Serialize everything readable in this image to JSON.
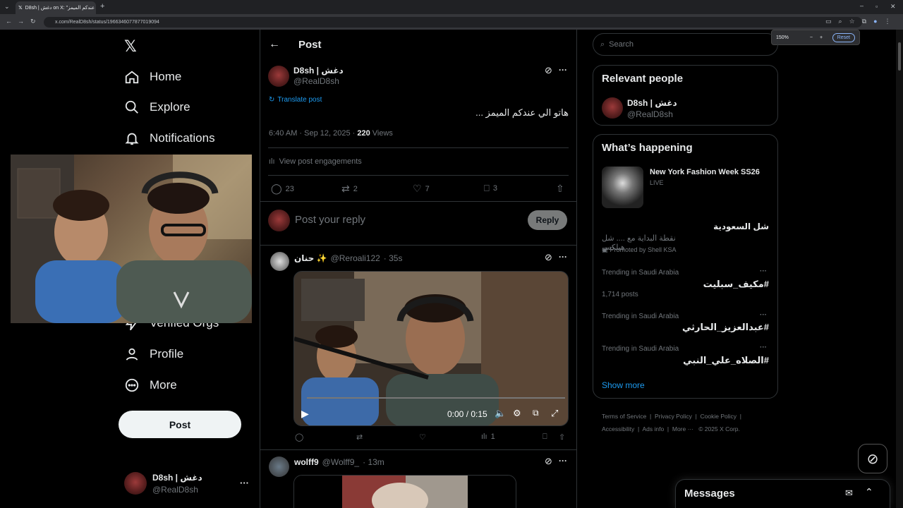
{
  "browser": {
    "tab_title": "D8sh | دغش on X: \"هاتو الي عندكم الميمز\" / X",
    "url": "x.com/RealD8sh/status/1966346077877019094",
    "zoom_level": "150%",
    "zoom_reset": "Reset",
    "zoom_minus": "−",
    "zoom_plus": "+"
  },
  "nav": {
    "items": [
      {
        "label": "Home",
        "icon": "home-icon"
      },
      {
        "label": "Explore",
        "icon": "search-icon"
      },
      {
        "label": "Notifications",
        "icon": "bell-icon"
      },
      {
        "label": "Verified Orgs",
        "icon": "lightning-icon"
      },
      {
        "label": "Profile",
        "icon": "person-icon"
      },
      {
        "label": "More",
        "icon": "more-circle-icon"
      }
    ],
    "post_button": "Post",
    "account_name": "D8sh | دغش",
    "account_handle": "@RealD8sh",
    "account_more": "···"
  },
  "main": {
    "header_title": "Post",
    "tweet": {
      "author_name": "D8sh | دغش",
      "author_handle": "@RealD8sh",
      "translate": "Translate post",
      "text": "هاتو الي عندكم الميمز ...",
      "time": "6:40 AM · Sep 12, 2025 · ",
      "views_count": "220",
      "views_label": " Views",
      "engagements": "View post engagements",
      "replies": "23",
      "reposts": "2",
      "likes": "7",
      "bookmarks": "3"
    },
    "reply_box": {
      "placeholder": "Post your reply",
      "button": "Reply"
    },
    "replies": [
      {
        "author_name": "حنان ✨",
        "author_handle": "@Reroali122",
        "time": "· 35s",
        "video_time": "0:00 / 0:15",
        "views": "1"
      },
      {
        "author_name": "wolff9",
        "author_handle": "@Wolff9_",
        "time": "· 13m"
      }
    ]
  },
  "sidebar": {
    "search_placeholder": "Search",
    "relevant_title": "Relevant people",
    "relevant_name": "D8sh | دغش",
    "relevant_handle": "@RealD8sh",
    "happening_title": "What’s happening",
    "event_title": "New York Fashion Week SS26",
    "event_status": "LIVE",
    "promo_title": "شل السعودية",
    "promo_sub": "نقطة البداية مع .... شل هيلكس",
    "promo_by": "Promoted by Shell KSA",
    "trends": [
      {
        "label": "Trending in Saudi Arabia",
        "title": "#مكيف_سبليت",
        "posts": "1,714 posts"
      },
      {
        "label": "Trending in Saudi Arabia",
        "title": "#عبدالعزيز_الحارثي",
        "posts": ""
      },
      {
        "label": "Trending in Saudi Arabia",
        "title": "#الصلاه_علي_النبي",
        "posts": ""
      }
    ],
    "show_more": "Show more",
    "footer": [
      "Terms of Service",
      "Privacy Policy",
      "Cookie Policy",
      "Accessibility",
      "Ads info",
      "More ···",
      "© 2025 X Corp."
    ],
    "messages_title": "Messages"
  },
  "colors": {
    "accent": "#1d9bf0",
    "background": "#000000",
    "border": "#2f3336",
    "muted": "#71767b"
  }
}
